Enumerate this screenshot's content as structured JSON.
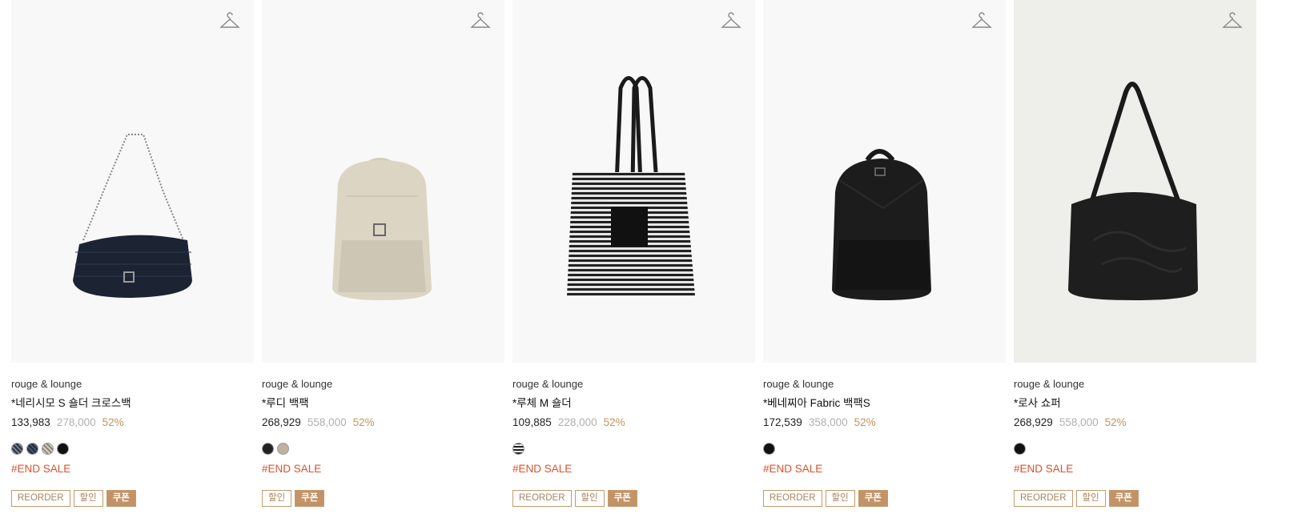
{
  "products": [
    {
      "brand": "rouge & lounge",
      "name": "*네리시모 S 숄더 크로스백",
      "price": "133,983",
      "original_price": "278,000",
      "discount": "52%",
      "swatches": [
        "pattern-navy",
        "pattern-navy",
        "pattern-light",
        "#111111"
      ],
      "sale_tag": "#END SALE",
      "badges": [
        "REORDER",
        "할인",
        "쿠폰"
      ]
    },
    {
      "brand": "rouge & lounge",
      "name": "*루디 백팩",
      "price": "268,929",
      "original_price": "558,000",
      "discount": "52%",
      "swatches": [
        "#222222",
        "#bfb3a0"
      ],
      "sale_tag": "#END SALE",
      "badges": [
        "할인",
        "쿠폰"
      ]
    },
    {
      "brand": "rouge & lounge",
      "name": "*루체 M 숄더",
      "price": "109,885",
      "original_price": "228,000",
      "discount": "52%",
      "swatches": [
        "stripes"
      ],
      "sale_tag": "#END SALE",
      "badges": [
        "REORDER",
        "할인",
        "쿠폰"
      ]
    },
    {
      "brand": "rouge & lounge",
      "name": "*베네찌아 Fabric 백팩S",
      "price": "172,539",
      "original_price": "358,000",
      "discount": "52%",
      "swatches": [
        "#111111"
      ],
      "sale_tag": "#END SALE",
      "badges": [
        "REORDER",
        "할인",
        "쿠폰"
      ]
    },
    {
      "brand": "rouge & lounge",
      "name": "*로사 쇼퍼",
      "price": "268,929",
      "original_price": "558,000",
      "discount": "52%",
      "swatches": [
        "#111111"
      ],
      "sale_tag": "#END SALE",
      "badges": [
        "REORDER",
        "할인",
        "쿠폰"
      ]
    }
  ],
  "icons": {
    "wishlist": "hanger-icon"
  },
  "colors": {
    "accent": "#c39367",
    "sale": "#d9532c",
    "discount": "#c4935a",
    "original_price": "#b0b0b0"
  }
}
